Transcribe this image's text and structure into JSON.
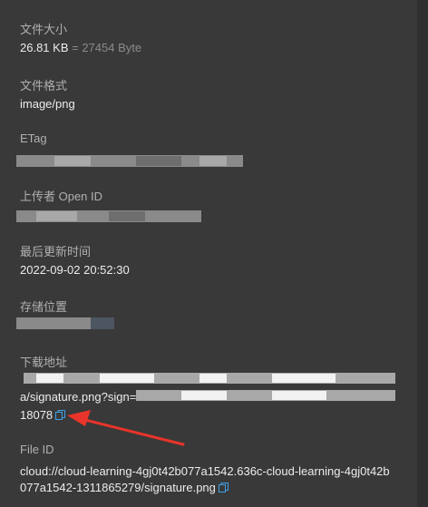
{
  "file_size": {
    "label": "文件大小",
    "kb": "26.81 KB",
    "byte": "= 27454 Byte"
  },
  "file_format": {
    "label": "文件格式",
    "value": "image/png"
  },
  "etag": {
    "label": "ETag"
  },
  "uploader": {
    "label": "上传者 Open ID"
  },
  "last_updated": {
    "label": "最后更新时间",
    "value": "2022-09-02 20:52:30"
  },
  "storage_location": {
    "label": "存储位置"
  },
  "download_url": {
    "label": "下载地址",
    "line2_visible": "a/signature.png?sign=",
    "line3": "18078"
  },
  "file_id": {
    "label": "File ID",
    "line1": "cloud://cloud-learning-4gj0t42b077a1542.636c-cloud-learning-4gj0t42b",
    "line2": "077a1542-1311865279/signature.png"
  },
  "colors": {
    "background": "#393939",
    "label": "#b0b0b0",
    "value": "#ececec",
    "copy_icon": "#3ea0e6",
    "arrow": "#e8342a"
  },
  "icons": {
    "copy": "copy-icon",
    "arrow": "red-arrow-annotation"
  }
}
